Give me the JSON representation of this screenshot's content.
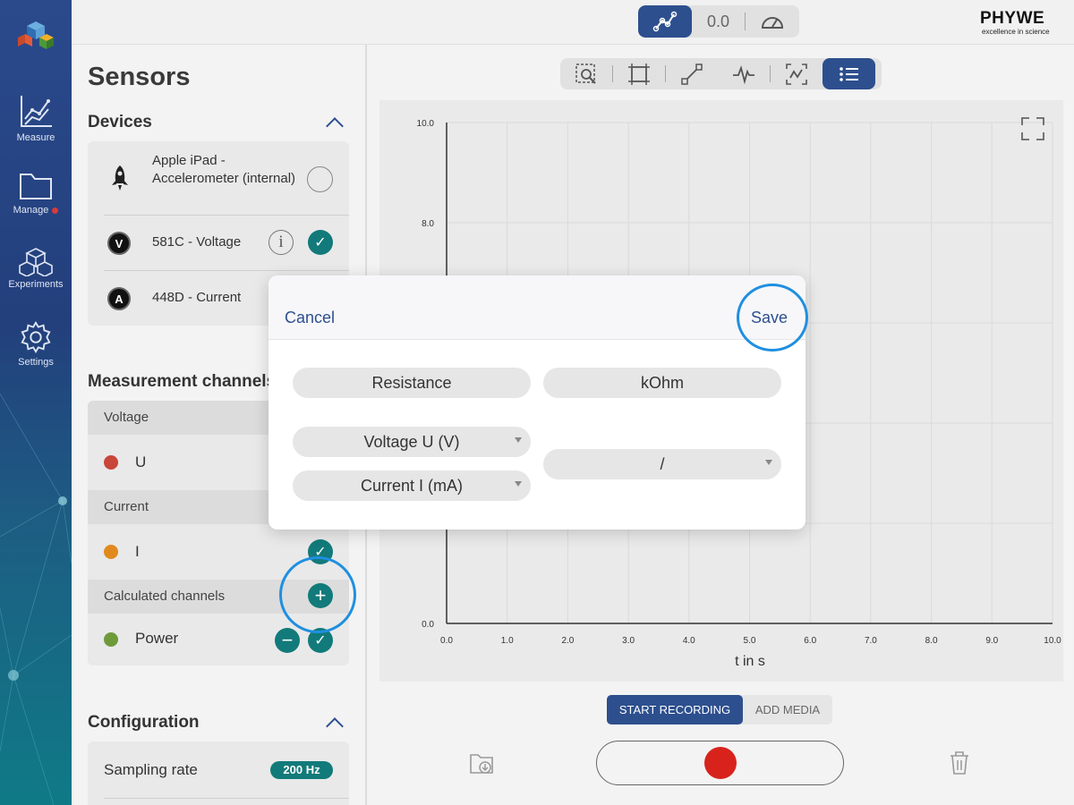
{
  "brand": {
    "name": "PHYWE",
    "tagline": "excellence in science"
  },
  "rail": {
    "items": [
      {
        "label": "Measure",
        "icon": "chart-line-icon"
      },
      {
        "label": "Manage",
        "icon": "folder-icon"
      },
      {
        "label": "Experiments",
        "icon": "cubes-icon"
      },
      {
        "label": "Settings",
        "icon": "gear-icon"
      }
    ]
  },
  "topbar": {
    "center_value": "0.0"
  },
  "sensors": {
    "title": "Sensors",
    "devices_title": "Devices",
    "devices": [
      {
        "name": "Apple iPad - Accelerometer (internal)",
        "badge": ""
      },
      {
        "name": "581C - Voltage",
        "badge": "V"
      },
      {
        "name": "448D - Current",
        "badge": "A"
      }
    ],
    "channels_title": "Measurement channels",
    "groups": [
      {
        "header": "Voltage",
        "channel": "U",
        "color": "#c8463a"
      },
      {
        "header": "Current",
        "channel": "I",
        "color": "#e08a1e"
      },
      {
        "header": "Calculated channels",
        "channel": "Power",
        "color": "#6f9a3a"
      }
    ],
    "config_title": "Configuration",
    "sampling_label": "Sampling rate",
    "sampling_value": "200 Hz"
  },
  "chart_data": {
    "type": "line",
    "x": [],
    "series": [],
    "xlabel": "t in s",
    "ylabel": "",
    "xlim": [
      0,
      10
    ],
    "ylim": [
      0,
      10
    ],
    "xticks": [
      "0.0",
      "1.0",
      "2.0",
      "3.0",
      "4.0",
      "5.0",
      "6.0",
      "7.0",
      "8.0",
      "9.0",
      "10.0"
    ],
    "yticks_visible": [
      "0.0",
      "8.0",
      "10.0"
    ],
    "grid": true
  },
  "bottom": {
    "start_recording": "START RECORDING",
    "add_media": "ADD MEDIA"
  },
  "dialog": {
    "cancel": "Cancel",
    "save": "Save",
    "name_value": "Resistance",
    "unit_value": "kOhm",
    "operand1": "Voltage U (V)",
    "operand2": "Current I (mA)",
    "operator": "/"
  },
  "colors": {
    "accent": "#2d4f8e",
    "teal": "#127a7a",
    "record": "#d8231c",
    "highlight_ring": "#1f8fe0"
  }
}
